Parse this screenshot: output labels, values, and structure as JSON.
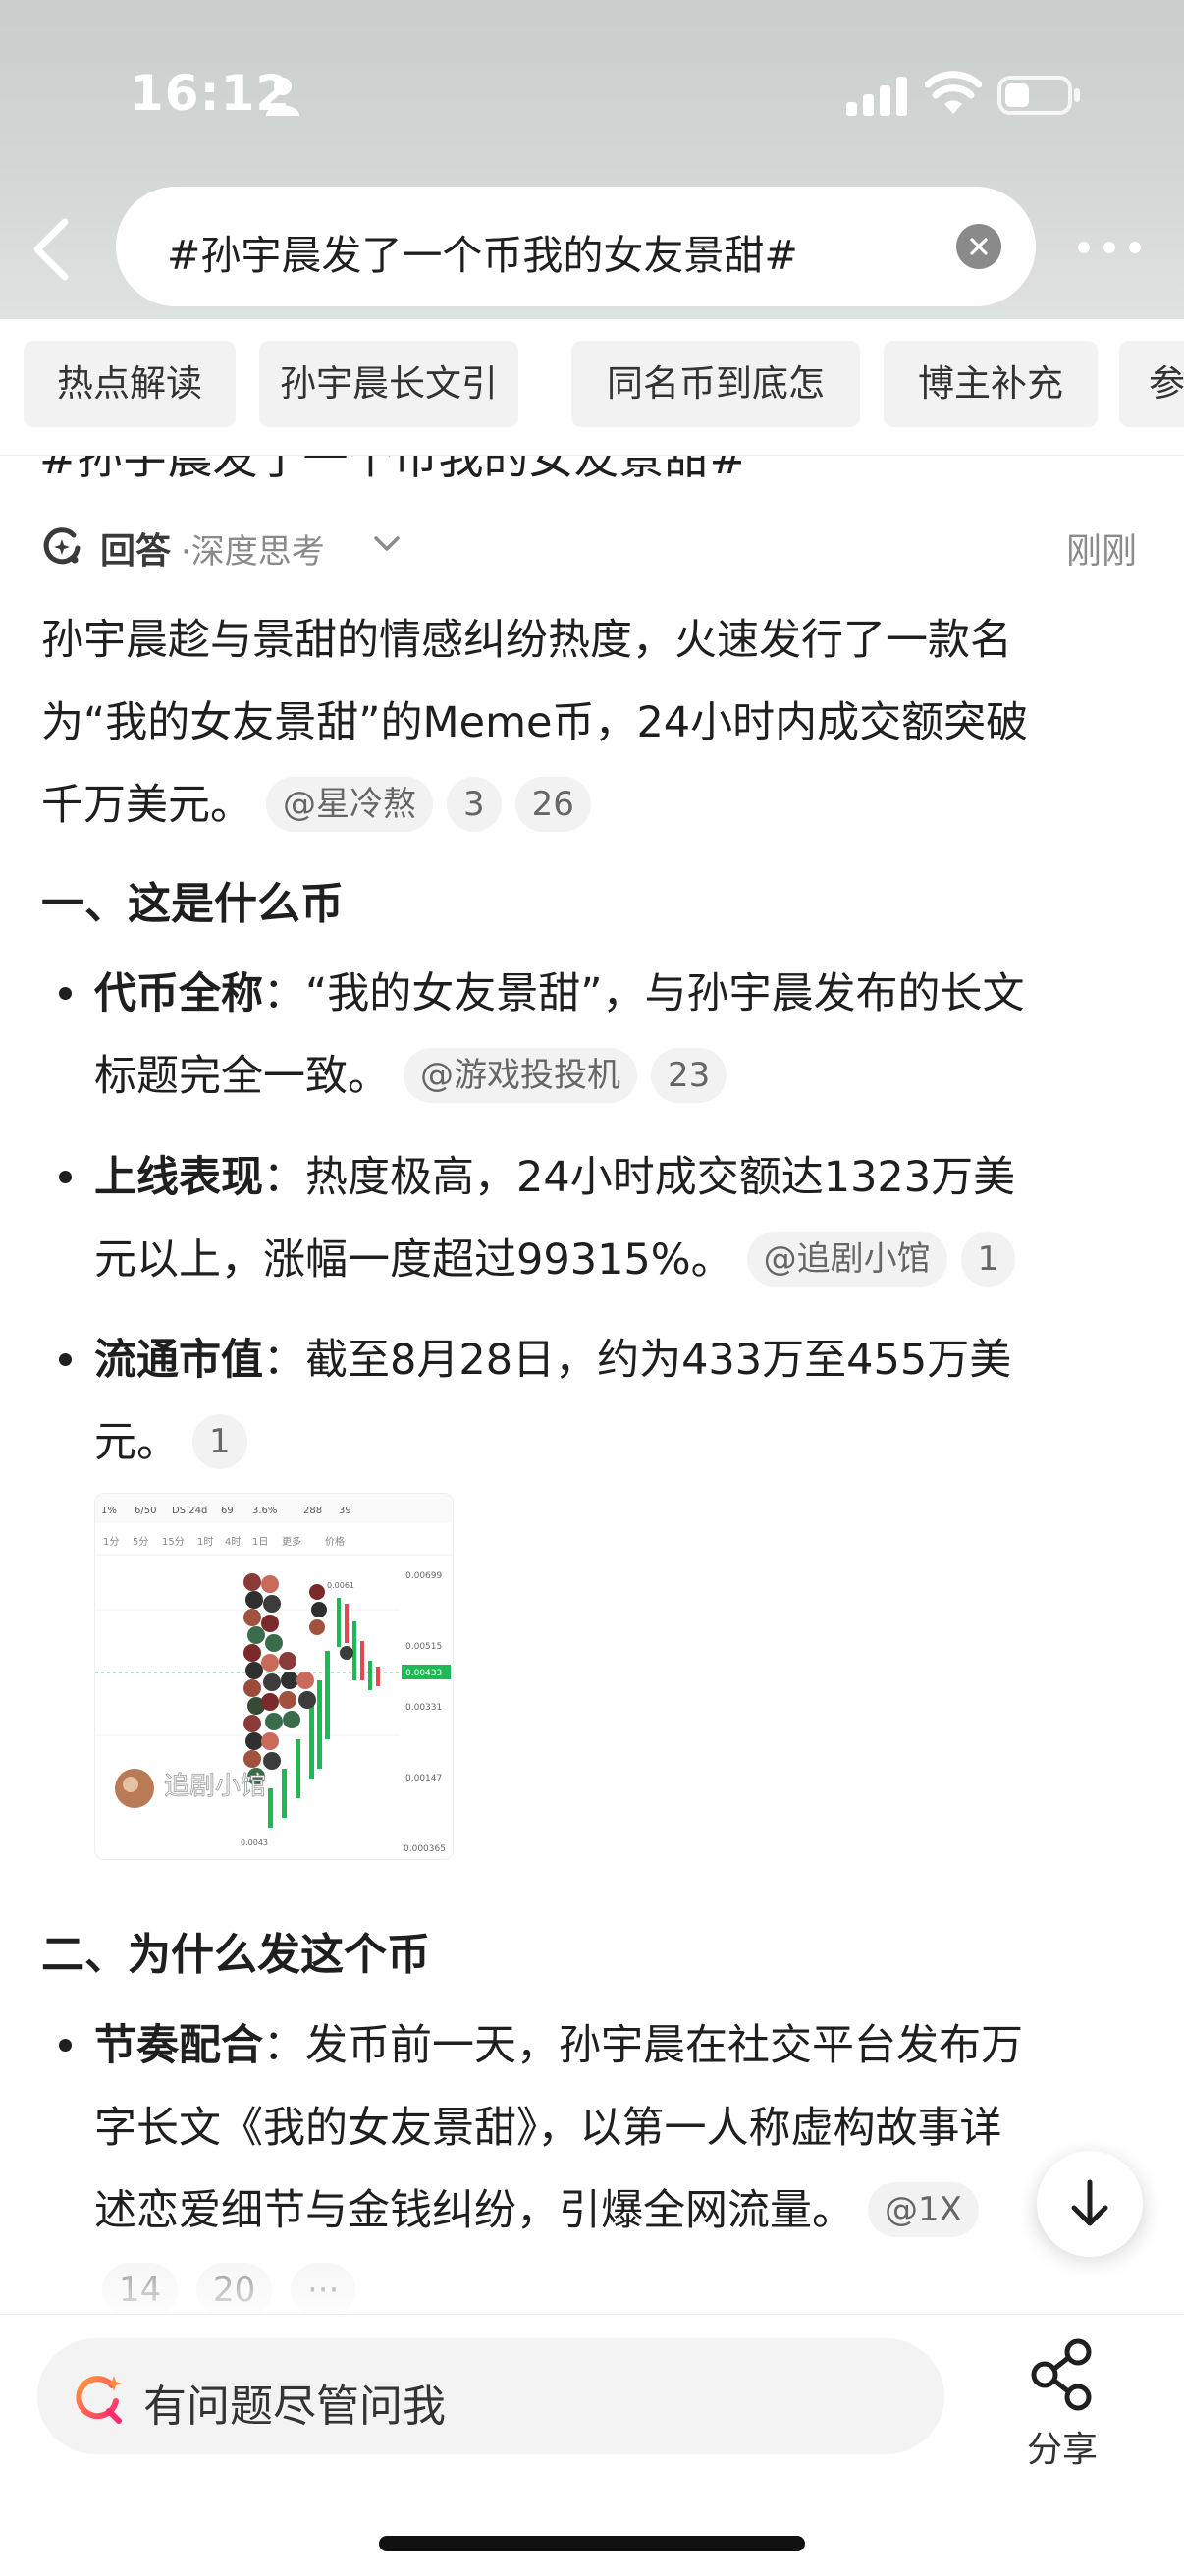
{
  "status_bar": {
    "time": "16:12"
  },
  "search": {
    "query": "#孙宇晨发了一个币我的女友景甜#"
  },
  "chips": [
    "热点解读",
    "孙宇晨长文引",
    "同名币到底怎",
    "博主补充",
    "参"
  ],
  "answer": {
    "label": "回答",
    "mode": "·深度思考",
    "time": "刚刚",
    "intro_lines": [
      "孙宇晨趁与景甜的情感纠纷热度，火速发行了一款名",
      "为“我的女友景甜”的Meme币，24小时内成交额突破",
      "千万美元。"
    ],
    "intro_refs": [
      "@星冷熬",
      "3",
      "26"
    ],
    "section1": {
      "heading": "一、这是什么币",
      "items": [
        {
          "term": "代币全称",
          "lines": [
            "：“我的女友景甜”，与孙宇晨发布的长文",
            "标题完全一致。"
          ],
          "refs": [
            "@游戏投投机",
            "23"
          ]
        },
        {
          "term": "上线表现",
          "lines": [
            "：热度极高，24小时成交额达1323万美",
            "元以上，涨幅一度超过99315%。"
          ],
          "refs": [
            "@追剧小馆",
            "1"
          ]
        },
        {
          "term": "流通市值",
          "lines": [
            "：截至8月28日，约为433万至455万美",
            "元。"
          ],
          "refs": [
            "1"
          ]
        }
      ]
    },
    "section2": {
      "heading": "二、为什么发这个币",
      "items": [
        {
          "term": "节奏配合",
          "lines": [
            "：发币前一天，孙宇晨在社交平台发布万",
            "字长文《我的女友景甜》，以第一人称虚构故事详",
            "述恋爱细节与金钱纠纷，引爆全网流量。"
          ],
          "refs": [
            "@1X",
            "14",
            "20",
            "···"
          ]
        }
      ]
    }
  },
  "chart_thumb": {
    "stats": [
      "1%",
      "6/50",
      "DS 24d",
      "69",
      "3.6%",
      "288",
      "39"
    ],
    "timeframes": [
      "1分",
      "5分",
      "15分",
      "1时",
      "4时",
      "1日",
      "更多",
      "价格"
    ],
    "price_labels": [
      "0.00699",
      "0.00515",
      "0.00433",
      "0.00331",
      "0.00147",
      "0.000365"
    ],
    "peak_label": "0.0061",
    "low_label": "0.0043",
    "watermark": "追剧小馆"
  },
  "bottom": {
    "ask_placeholder": "有问题尽管问我",
    "share_label": "分享"
  },
  "colors": {
    "accent_pink": "#ff3d6e",
    "candle_green": "#1db954",
    "candle_red": "#e5484d"
  }
}
